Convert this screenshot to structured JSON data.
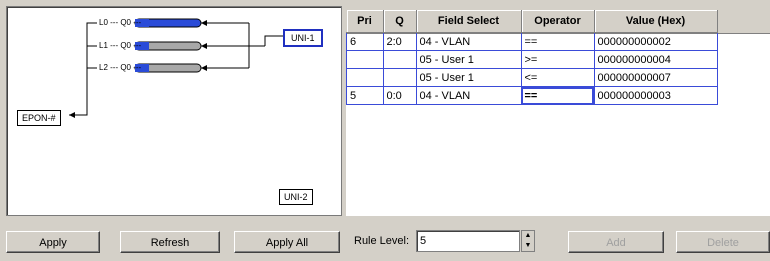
{
  "diagram": {
    "uni1_label": "UNI-1",
    "uni2_label": "UNI-2",
    "epon_label": "EPON-#",
    "queues": [
      {
        "label": "L0 --- Q0 ---",
        "color": "#2a4bd8"
      },
      {
        "label": "L1 --- Q0 ---",
        "color": "#a0a0a0"
      },
      {
        "label": "L2 --- Q0 ---",
        "color": "#a0a0a0"
      }
    ]
  },
  "table": {
    "headers": [
      "Pri",
      "Q",
      "Field Select",
      "Operator",
      "Value (Hex)"
    ],
    "rows": [
      {
        "pri": "6",
        "q": "2:0",
        "field": "04 - VLAN",
        "operator": "==",
        "value": "000000000002"
      },
      {
        "pri": "",
        "q": "",
        "field": "05 - User 1",
        "operator": ">=",
        "value": "000000000004"
      },
      {
        "pri": "",
        "q": "",
        "field": "05 - User 1",
        "operator": "<=",
        "value": "000000000007"
      },
      {
        "pri": "5",
        "q": "0:0",
        "field": "04 - VLAN",
        "operator": "==",
        "value": "000000000003"
      }
    ]
  },
  "buttons": {
    "apply": "Apply",
    "refresh": "Refresh",
    "apply_all": "Apply All",
    "add": "Add",
    "delete": "Delete"
  },
  "rule_level": {
    "label": "Rule Level:",
    "value": "5"
  }
}
